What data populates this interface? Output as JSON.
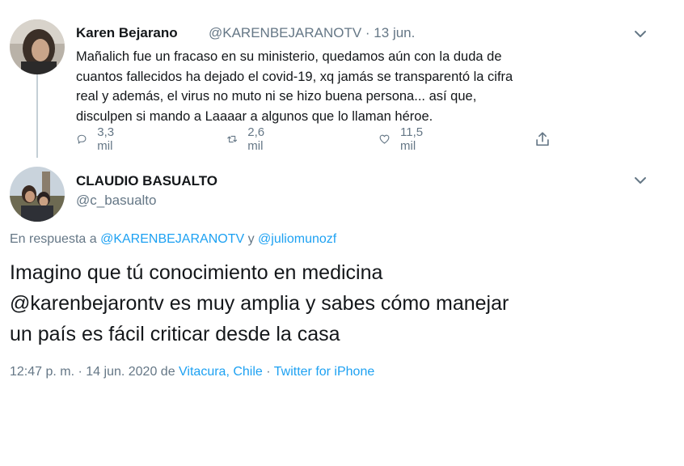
{
  "tweet1": {
    "author_name": "Karen Bejarano",
    "author_handle": "@KARENBEJARANOTV",
    "date": "· 13 jun.",
    "text_lines": [
      "Mañalich fue un fracaso en su ministerio, quedamos aún con la duda de",
      "cuantos fallecidos ha dejado el covid-19, xq jamás se transparentó la cifra",
      "real y además, el virus no muto ni se hizo buena persona... así que,",
      "disculpen si mando a Laaaar a algunos que lo llaman héroe."
    ],
    "replies": "3,3 mil",
    "retweets": "2,6 mil",
    "likes": "11,5 mil"
  },
  "tweet2": {
    "author_name": "CLAUDIO BASUALTO",
    "author_handle": "@c_basualto",
    "reply_prefix": "En respuesta a",
    "reply_to_1": "@KARENBEJARANOTV",
    "reply_conj": "y",
    "reply_to_2": "@juliomunozf",
    "text_lines": [
      "Imagino que tú conocimiento en medicina",
      "@karenbejarontv es muy amplia y sabes cómo manejar",
      "un país es fácil criticar desde la casa"
    ],
    "timestamp": "12:47 p. m. · 14 jun. 2020",
    "location_prefix": "de",
    "location": "Vitacura, Chile",
    "separator": "·",
    "source": "Twitter for iPhone"
  },
  "icons": {
    "reply": "reply-icon",
    "retweet": "retweet-icon",
    "like": "heart-icon",
    "share": "share-icon",
    "menu": "chevron-down-icon"
  },
  "colors": {
    "link": "#1da1f2",
    "secondary_text": "#657786",
    "primary_text": "#14171a",
    "thread_line": "#c4cfd6"
  }
}
